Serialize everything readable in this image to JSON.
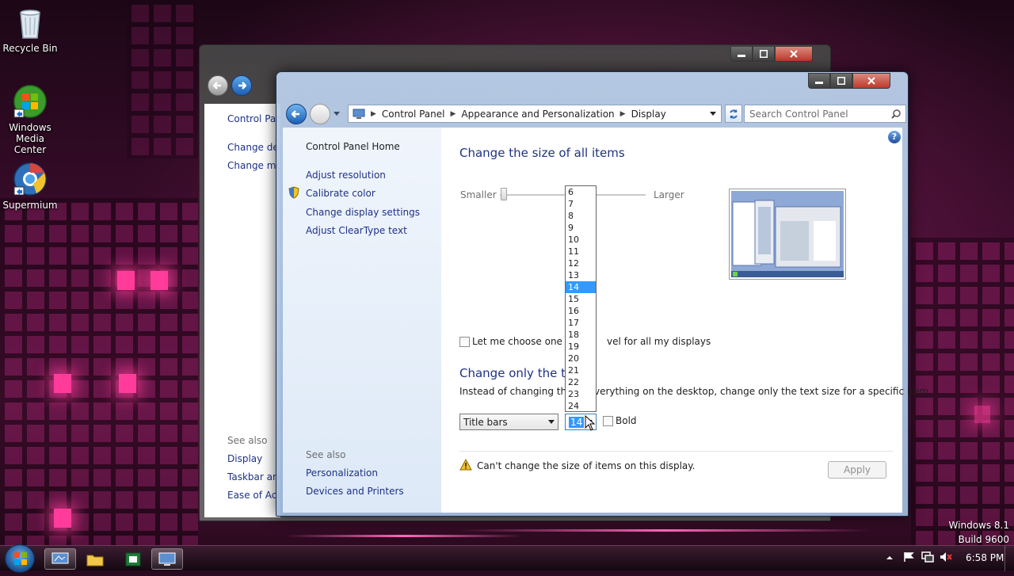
{
  "desktop": {
    "icons": [
      {
        "label": "Recycle Bin",
        "icon": "recycle-bin-icon"
      },
      {
        "label": "Windows Media Center",
        "label_line1": "Windows",
        "label_line2": "Media Center",
        "icon": "windows-media-center-icon"
      },
      {
        "label": "Supermium",
        "icon": "supermium-icon"
      }
    ],
    "watermark_line1": "Windows 8.1",
    "watermark_line2": "Build 9600"
  },
  "back_window": {
    "left_links": [
      "Control Pan",
      "Change des",
      "Change mo"
    ],
    "see_also": "See also",
    "see_also_links": [
      "Display",
      "Taskbar and",
      "Ease of Acc"
    ]
  },
  "window": {
    "breadcrumb": [
      "Control Panel",
      "Appearance and Personalization",
      "Display"
    ],
    "search_placeholder": "Search Control Panel",
    "help_glyph": "?",
    "left_pane": {
      "home": "Control Panel Home",
      "links": [
        "Adjust resolution",
        "Calibrate color",
        "Change display settings",
        "Adjust ClearType text"
      ],
      "see_also": "See also",
      "see_also_links": [
        "Personalization",
        "Devices and Printers"
      ]
    },
    "main": {
      "heading1": "Change the size of all items",
      "slider_smaller": "Smaller",
      "slider_larger": "Larger",
      "checkbox_label_a": "Let me choose one sca",
      "checkbox_label_b": "vel for all my displays",
      "heading2": "Change only the tex",
      "description_a": "Instead of changing the s",
      "description_b": "verything on the desktop, change only the text size for a specific item.",
      "item_select_value": "Title bars",
      "size_select_value": "14",
      "size_options": [
        "6",
        "7",
        "8",
        "9",
        "10",
        "11",
        "12",
        "13",
        "14",
        "15",
        "16",
        "17",
        "18",
        "19",
        "20",
        "21",
        "22",
        "23",
        "24"
      ],
      "selected_size_index": 8,
      "bold_label": "Bold",
      "warning": "Can't change the size of items on this display.",
      "apply_label": "Apply"
    }
  },
  "taskbar": {
    "clock": "6:58 PM"
  },
  "colors": {
    "link": "#1e3287",
    "heading": "#1e3287",
    "selection": "#3399ff",
    "close_button": "#c0392b"
  }
}
